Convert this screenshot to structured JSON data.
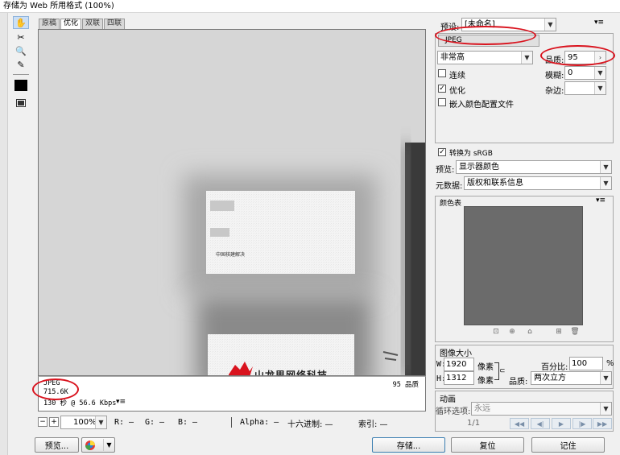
{
  "window": {
    "title": "存储为 Web 所用格式 (100%)"
  },
  "tabs": [
    "原稿",
    "优化",
    "双联",
    "四联"
  ],
  "active_tab": 1,
  "canvas": {
    "card_text": "中国核建解决",
    "card2_text": "山龙思网络科技"
  },
  "preview_info": {
    "format": "JPEG",
    "size": "715.6K",
    "time": "130 秒 @ 56.6 Kbps",
    "quality_label": "95 品质"
  },
  "statusbar": {
    "zoom": "100%",
    "r": "R: —",
    "g": "G: —",
    "b": "B: —",
    "alpha": "Alpha: —",
    "hex": "十六进制: —",
    "index": "索引: —"
  },
  "buttons": {
    "preview": "预览...",
    "save": "存储...",
    "reset": "复位",
    "remember": "记住"
  },
  "settings": {
    "preset_label": "预设:",
    "preset_value": "[未命名]",
    "format": "JPEG",
    "quality_level": "非常高",
    "quality_label": "品质:",
    "quality_value": "95",
    "blur_label": "模糊:",
    "blur_value": "0",
    "matte_label": "杂边:",
    "progressive_label": "连续",
    "progressive_checked": false,
    "optimized_label": "优化",
    "optimized_checked": true,
    "embed_profile_label": "嵌入颜色配置文件",
    "embed_profile_checked": false,
    "convert_srgb_label": "转换为 sRGB",
    "convert_srgb_checked": true,
    "preview_label": "预览:",
    "preview_value": "显示器颜色",
    "metadata_label": "元数据:",
    "metadata_value": "版权和联系信息"
  },
  "color_table": {
    "title": "颜色表"
  },
  "image_size": {
    "title": "图像大小",
    "w_label": "W:",
    "w_value": "1920",
    "h_label": "H:",
    "h_value": "1312",
    "unit": "像素",
    "percent_label": "百分比:",
    "percent_value": "100",
    "percent_unit": "%",
    "quality_label": "品质:",
    "quality_value": "两次立方"
  },
  "animation": {
    "title": "动画",
    "loop_label": "循环选项:",
    "loop_value": "永远",
    "frame": "1/1"
  },
  "colors": {
    "highlight": "#d9131e",
    "accent_blue": "#3c7fb1"
  }
}
